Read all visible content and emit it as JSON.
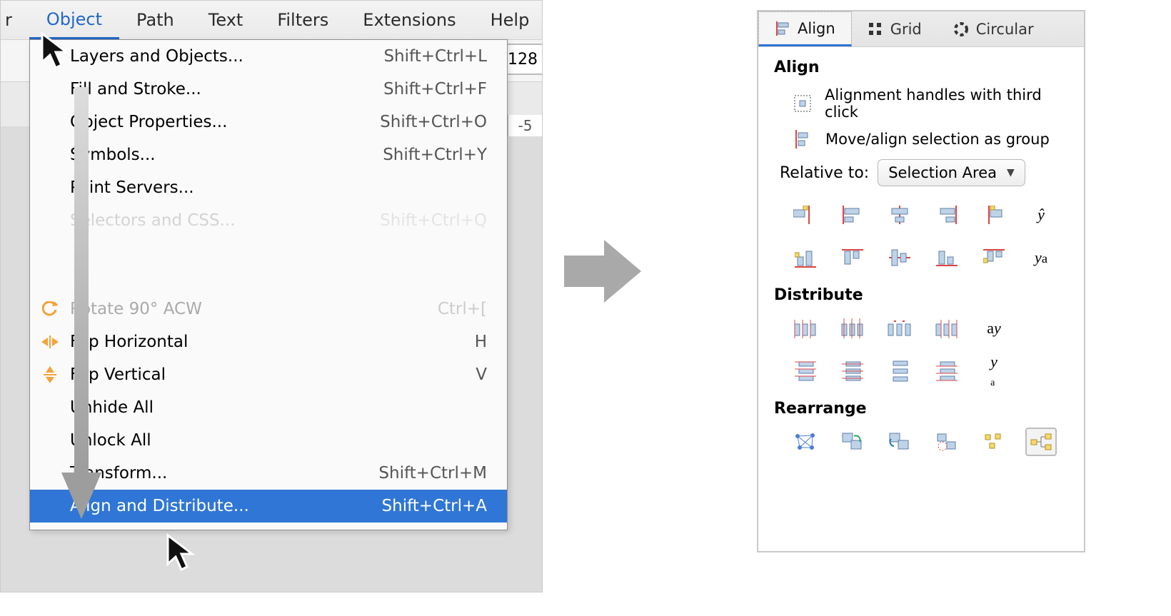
{
  "menubar": {
    "trunc_left": "r",
    "items": [
      "Object",
      "Path",
      "Text",
      "Filters",
      "Extensions",
      "Help"
    ],
    "active_index": 0
  },
  "toolbar": {
    "num_value": "128",
    "ruler_tick": "-5"
  },
  "dropdown": {
    "top_items": [
      {
        "label": "Layers and Objects...",
        "accel": "Shift+Ctrl+L"
      },
      {
        "label": "Fill and Stroke...",
        "accel": "Shift+Ctrl+F"
      },
      {
        "label": "Object Properties...",
        "accel": "Shift+Ctrl+O"
      },
      {
        "label": "Symbols...",
        "accel": "Shift+Ctrl+Y"
      },
      {
        "label": "Paint Servers...",
        "accel": ""
      },
      {
        "label": "Selectors and CSS...",
        "accel": "Shift+Ctrl+Q"
      }
    ],
    "bottom_items": [
      {
        "label": "Rotate 90° ACW",
        "accel": "Ctrl+[",
        "icon": "rotate-acw",
        "dim": true
      },
      {
        "label": "Flip Horizontal",
        "accel": "H",
        "icon": "flip-h"
      },
      {
        "label": "Flip Vertical",
        "accel": "V",
        "icon": "flip-v"
      },
      {
        "label": "Unhide All",
        "accel": ""
      },
      {
        "label": "Unlock All",
        "accel": ""
      },
      {
        "label": "Transform...",
        "accel": "Shift+Ctrl+M"
      },
      {
        "label": "Align and Distribute...",
        "accel": "Shift+Ctrl+A",
        "highlight": true
      }
    ]
  },
  "dialog": {
    "tabs": [
      {
        "label": "Align",
        "icon": "align"
      },
      {
        "label": "Grid",
        "icon": "grid"
      },
      {
        "label": "Circular",
        "icon": "circular"
      }
    ],
    "active_tab": 0,
    "align": {
      "title": "Align",
      "opt_handles": "Alignment handles with third click",
      "opt_group": "Move/align selection as group",
      "relative_label": "Relative to:",
      "relative_value": "Selection Area",
      "row1": [
        "align-left-out",
        "align-left",
        "align-hcenter",
        "align-right",
        "align-right-out",
        "text-align-y"
      ],
      "row2": [
        "align-bottom-out",
        "align-top",
        "align-vcenter",
        "align-bottom",
        "align-top-out",
        "text-align-ya"
      ]
    },
    "distribute": {
      "title": "Distribute",
      "row1": [
        "dist-left",
        "dist-hcenter",
        "dist-hgap",
        "dist-right",
        "text-dist-ay"
      ],
      "row2": [
        "dist-top",
        "dist-vcenter",
        "dist-vgap",
        "dist-bottom",
        "text-dist-ya2"
      ]
    },
    "rearrange": {
      "title": "Rearrange",
      "row": [
        "graph",
        "swap-z",
        "swap-pos",
        "randomize",
        "unclump",
        "tree"
      ],
      "pressed_index": 5
    }
  }
}
